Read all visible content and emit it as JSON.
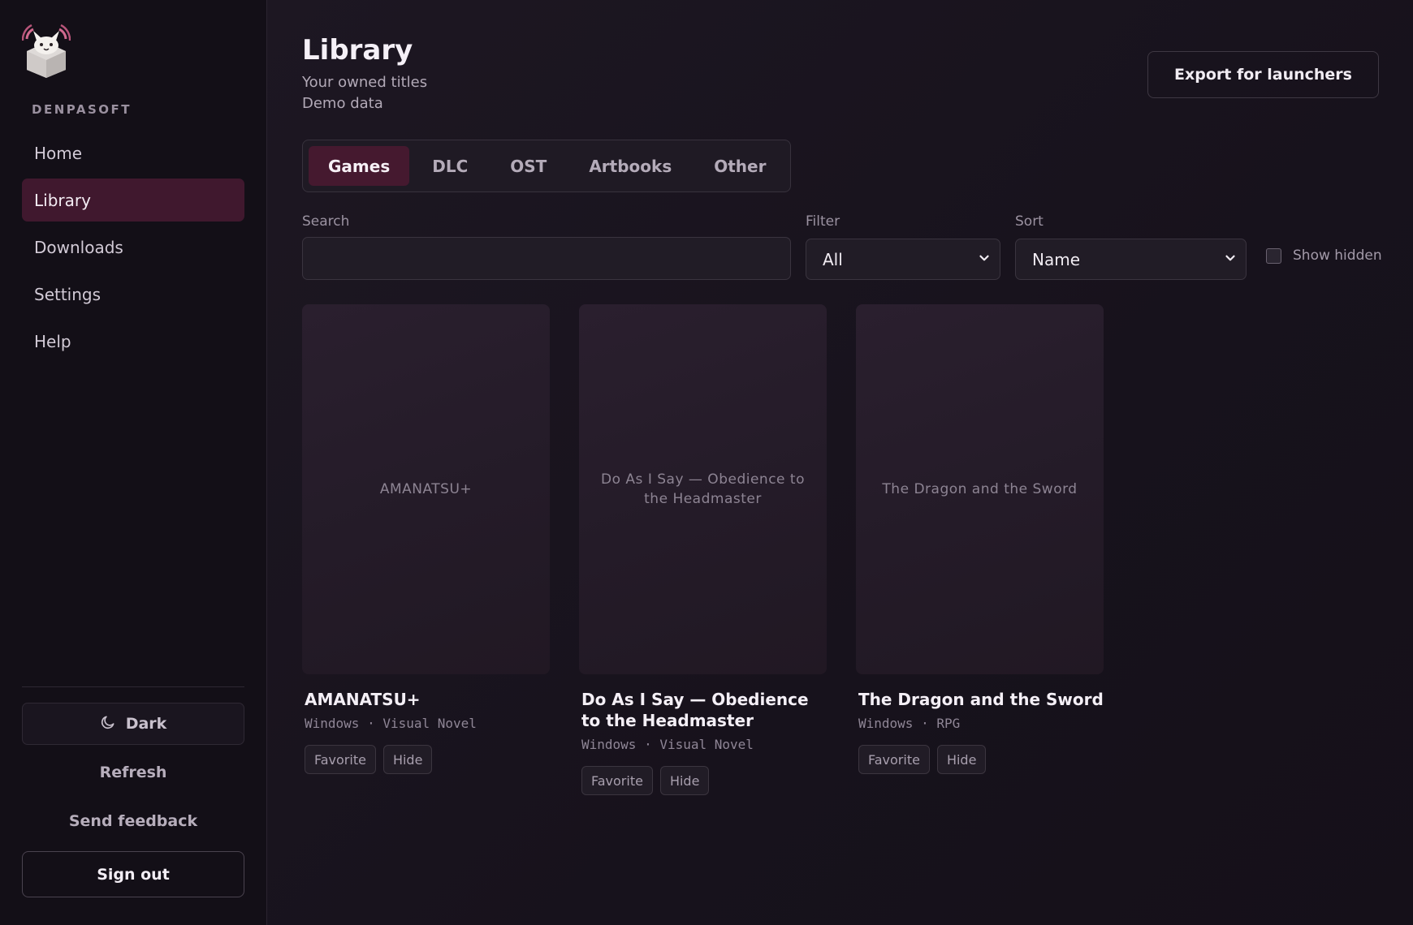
{
  "sidebar": {
    "brand": "DENPASOFT",
    "nav": [
      {
        "label": "Home",
        "active": false
      },
      {
        "label": "Library",
        "active": true
      },
      {
        "label": "Downloads",
        "active": false
      },
      {
        "label": "Settings",
        "active": false
      },
      {
        "label": "Help",
        "active": false
      }
    ],
    "theme_label": "Dark",
    "refresh_label": "Refresh",
    "feedback_label": "Send feedback",
    "signout_label": "Sign out"
  },
  "header": {
    "title": "Library",
    "subtitle": "Your owned titles",
    "subtitle2": "Demo data",
    "export_label": "Export for launchers"
  },
  "tabs": [
    {
      "label": "Games",
      "active": true
    },
    {
      "label": "DLC",
      "active": false
    },
    {
      "label": "OST",
      "active": false
    },
    {
      "label": "Artbooks",
      "active": false
    },
    {
      "label": "Other",
      "active": false
    }
  ],
  "controls": {
    "search_label": "Search",
    "search_value": "",
    "filter_label": "Filter",
    "filter_value": "All",
    "sort_label": "Sort",
    "sort_value": "Name",
    "show_hidden_label": "Show hidden",
    "show_hidden_checked": false
  },
  "games": [
    {
      "cover_text": "AMANATSU+",
      "title": "AMANATSU+",
      "meta": "Windows · Visual Novel",
      "favorite_label": "Favorite",
      "hide_label": "Hide"
    },
    {
      "cover_text": "Do As I Say — Obedience to the Headmaster",
      "title": "Do As I Say — Obedience to the Headmaster",
      "meta": "Windows · Visual Novel",
      "favorite_label": "Favorite",
      "hide_label": "Hide"
    },
    {
      "cover_text": "The Dragon and the Sword",
      "title": "The Dragon and the Sword",
      "meta": "Windows · RPG",
      "favorite_label": "Favorite",
      "hide_label": "Hide"
    }
  ],
  "colors": {
    "accent": "#45192f",
    "background": "#17121d",
    "sidebar": "#130f17"
  }
}
